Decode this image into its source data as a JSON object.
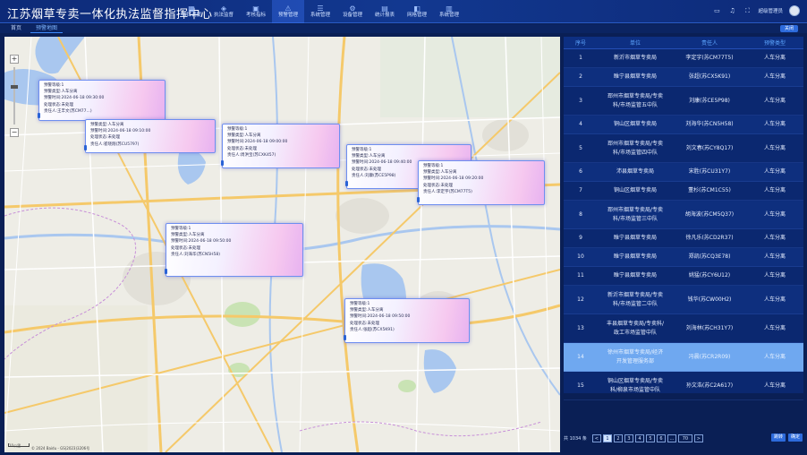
{
  "header": {
    "title": "江苏烟草专卖一体化执法监督指挥中心",
    "nav": [
      {
        "icon": "▦",
        "label": "指挥调度",
        "active": false
      },
      {
        "icon": "◈",
        "label": "执法监督",
        "active": false
      },
      {
        "icon": "▣",
        "label": "考核指标",
        "active": false
      },
      {
        "icon": "⚠",
        "label": "预警管理",
        "active": true
      },
      {
        "icon": "☰",
        "label": "系统管理",
        "active": false
      },
      {
        "icon": "⚙",
        "label": "设备管理",
        "active": false
      },
      {
        "icon": "▤",
        "label": "统计报表",
        "active": false
      },
      {
        "icon": "◧",
        "label": "网格管理",
        "active": false
      },
      {
        "icon": "▥",
        "label": "系统管理",
        "active": false
      }
    ],
    "user_name": "超级管理员"
  },
  "tabs": {
    "home": "首页",
    "current": "预警地图",
    "right_button": "关闭"
  },
  "map": {
    "attribution": "© 2024 Baidu - GS(2023)3206号",
    "scale": "10公里"
  },
  "popups": [
    {
      "lines": [
        "预警等级:1",
        "预警类型:人车分离",
        "预警时间:2024-06-18 09:30:00",
        "处理状态:未处理",
        "责任人:王丰文(苏CM77...)"
      ]
    },
    {
      "lines": [
        "预警类型:人车分离",
        "预警时间:2024-06-18 09:10:00",
        "处理状态:未处理",
        "责任人:崔晓翔(苏CU5797)"
      ]
    },
    {
      "lines": [
        "预警等级:1",
        "预警类型:人车分离",
        "预警时间:2024-06-18 09:00:00",
        "处理状态:未处理",
        "责任人:周洪宝(苏CXK457)"
      ]
    },
    {
      "lines": [
        "预警等级:1",
        "预警类型:人车分离",
        "预警时间:2024-06-18 09:40:00",
        "处理状态:未处理",
        "责任人:刘康(苏CE5P98)"
      ]
    },
    {
      "lines": [
        "预警等级:1",
        "预警类型:人车分离",
        "预警时间:2024-06-18 09:20:00",
        "处理状态:未处理",
        "责任人:李定宇(苏CM77T5)"
      ]
    },
    {
      "lines": [
        "预警等级:1",
        "预警类型:人车分离",
        "预警时间:2024-06-18 09:50:00",
        "处理状态:未处理",
        "责任人:刘海华(苏CN5H58)"
      ]
    },
    {
      "lines": [
        "预警等级:1",
        "预警类型:人车分离",
        "预警时间:2024-06-18 09:50:00",
        "处理状态:未处理",
        "责任人:张超(苏CX5K91)"
      ]
    }
  ],
  "list": {
    "headers": [
      "序号",
      "单位",
      "责任人",
      "预警类型"
    ],
    "rows": [
      {
        "no": "1",
        "unit": [
          "新沂市烟草专卖局"
        ],
        "person": "李定宇(苏CM77T5)",
        "type": "人车分离",
        "selected": false
      },
      {
        "no": "2",
        "unit": [
          "睢宁县烟草专卖局"
        ],
        "person": "张超(苏CX5K91)",
        "type": "人车分离",
        "selected": false
      },
      {
        "no": "3",
        "unit": [
          "邳州市烟草专卖局/专卖",
          "科/市场监管五中队"
        ],
        "person": "刘康(苏CE5P98)",
        "type": "人车分离",
        "selected": false
      },
      {
        "no": "4",
        "unit": [
          "铜山区烟草专卖局"
        ],
        "person": "刘海华(苏CN5H58)",
        "type": "人车分离",
        "selected": false
      },
      {
        "no": "5",
        "unit": [
          "邳州市烟草专卖局/专卖",
          "科/市场监管四中队"
        ],
        "person": "刘文春(苏CY8Q17)",
        "type": "人车分离",
        "selected": false
      },
      {
        "no": "6",
        "unit": [
          "沛县烟草专卖局"
        ],
        "person": "宋胜(苏CU31Y7)",
        "type": "人车分离",
        "selected": false
      },
      {
        "no": "7",
        "unit": [
          "铜山区烟草专卖局"
        ],
        "person": "董杉(苏CM1C55)",
        "type": "人车分离",
        "selected": false
      },
      {
        "no": "8",
        "unit": [
          "邳州市烟草专卖局/专卖",
          "科/市场监管三中队"
        ],
        "person": "胡海波(苏CM5Q37)",
        "type": "人车分离",
        "selected": false
      },
      {
        "no": "9",
        "unit": [
          "睢宁县烟草专卖局"
        ],
        "person": "徐凡乐(苏CD2R37)",
        "type": "人车分离",
        "selected": false
      },
      {
        "no": "10",
        "unit": [
          "睢宁县烟草专卖局"
        ],
        "person": "郑凯(苏CQ3E78)",
        "type": "人车分离",
        "selected": false
      },
      {
        "no": "11",
        "unit": [
          "睢宁县烟草专卖局"
        ],
        "person": "姚猛(苏CY6U12)",
        "type": "人车分离",
        "selected": false
      },
      {
        "no": "12",
        "unit": [
          "新沂市烟草专卖局/专卖",
          "科/市场监管二中队"
        ],
        "person": "钱华(苏CW00H2)",
        "type": "人车分离",
        "selected": false
      },
      {
        "no": "13",
        "unit": [
          "丰县烟草专卖局/专卖科/",
          "政工市场监管中队"
        ],
        "person": "刘海林(苏CH31Y7)",
        "type": "人车分离",
        "selected": false
      },
      {
        "no": "14",
        "unit": [
          "徐州市烟草专卖局/经济",
          "开发管理服务部"
        ],
        "person": "冯晨(苏CR2R09)",
        "type": "人车分离",
        "selected": true
      },
      {
        "no": "15",
        "unit": [
          "铜山区烟草专卖局/专卖",
          "科/柳泉市场监管中队"
        ],
        "person": "孙文浩(苏C2A617)",
        "type": "人车分离",
        "selected": false
      }
    ]
  },
  "pager": {
    "total": "共 1034 条",
    "prev": "<",
    "pages": [
      "1",
      "2",
      "3",
      "4",
      "5",
      "6",
      "...",
      "70"
    ],
    "next": ">",
    "buttons": [
      "跳转",
      "确定"
    ]
  },
  "colors": {
    "bg": "#0a1f55",
    "accent": "#3f8cff",
    "header_text": "#5ea6ff",
    "selected_row": "#6fa8f0"
  }
}
